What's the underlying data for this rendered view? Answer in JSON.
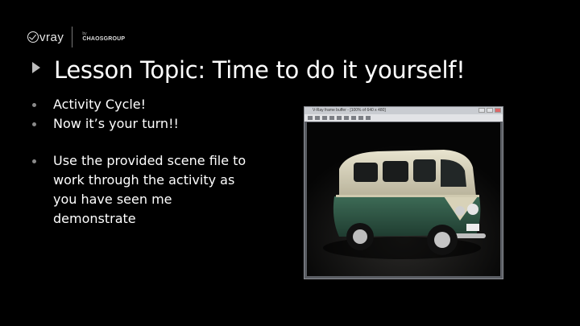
{
  "logo": {
    "brand": "vray",
    "by": "by",
    "company": "CHAOSGROUP"
  },
  "slide": {
    "title": "Lesson Topic: Time to do it yourself!",
    "bullets": [
      "Activity Cycle!",
      "Now it’s your turn!!",
      "Use the provided scene file to work through the activity as you have seen me demonstrate"
    ]
  },
  "render_window": {
    "title": "V-Ray frame buffer - [100% of 640 x 480]"
  },
  "colors": {
    "background": "#000000",
    "text": "#ffffff",
    "bullet": "#8a8a8a",
    "van_body": "#2f5a46",
    "van_top": "#d9d4bd"
  }
}
